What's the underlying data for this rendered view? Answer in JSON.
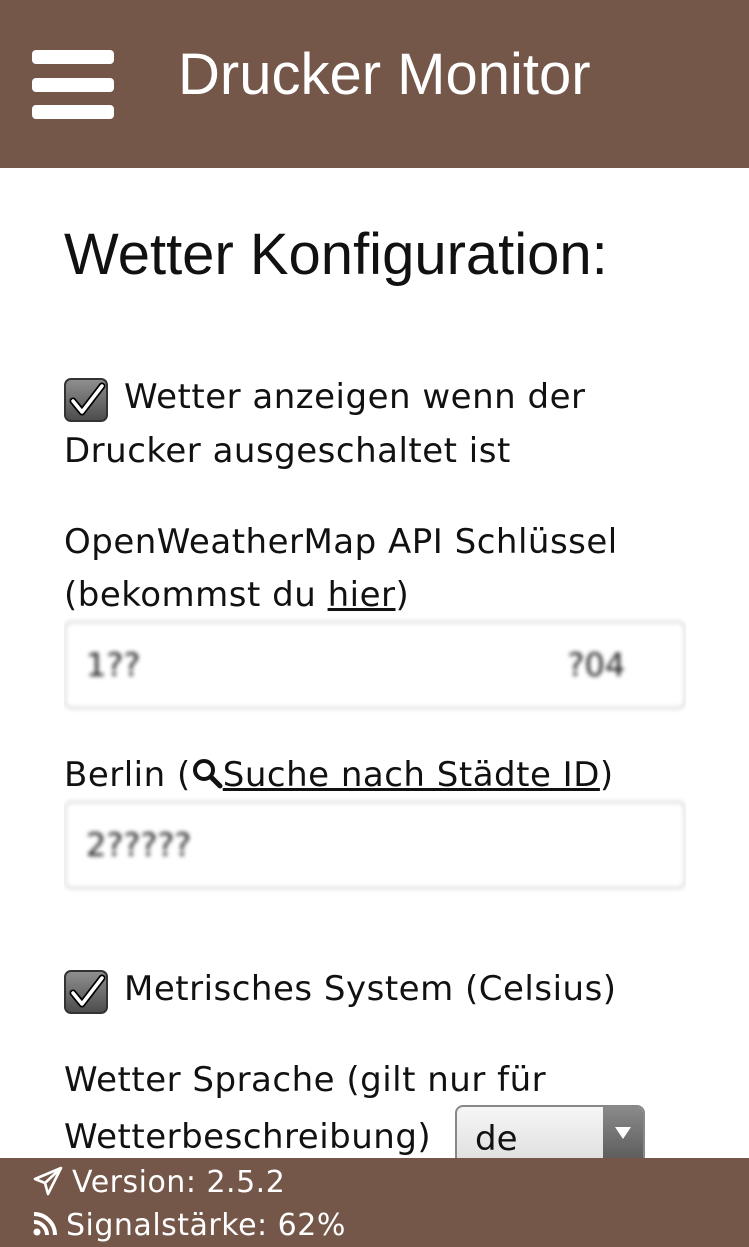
{
  "header": {
    "title": "Drucker Monitor",
    "menu_icon": "hamburger-menu-icon"
  },
  "main": {
    "heading": "Wetter Konfiguration:",
    "show_weather": {
      "checked": true,
      "label_line1": "Wetter anzeigen wenn der",
      "label_line2": "Drucker ausgeschaltet ist"
    },
    "api_key": {
      "label_line1": "OpenWeatherMap API Schlüssel",
      "label_prefix": "(bekommst du ",
      "link_text": "hier",
      "label_suffix": ")",
      "value": "1??                                          ?04"
    },
    "city": {
      "label_prefix": "Berlin (",
      "search_icon": "search-icon",
      "link_text": "Suche nach Städte ID",
      "label_suffix": ")",
      "value": "2?????"
    },
    "metric": {
      "checked": true,
      "label": "Metrisches System (Celsius)"
    },
    "language": {
      "label_line1": "Wetter Sprache (gilt nur für",
      "label_line2": "Wetterbeschreibung)",
      "selected": "de"
    }
  },
  "footer": {
    "version_icon": "paper-plane-icon",
    "version": "Version: 2.5.2",
    "signal_icon": "rss-icon",
    "signal": "Signalstärke: 62%"
  }
}
